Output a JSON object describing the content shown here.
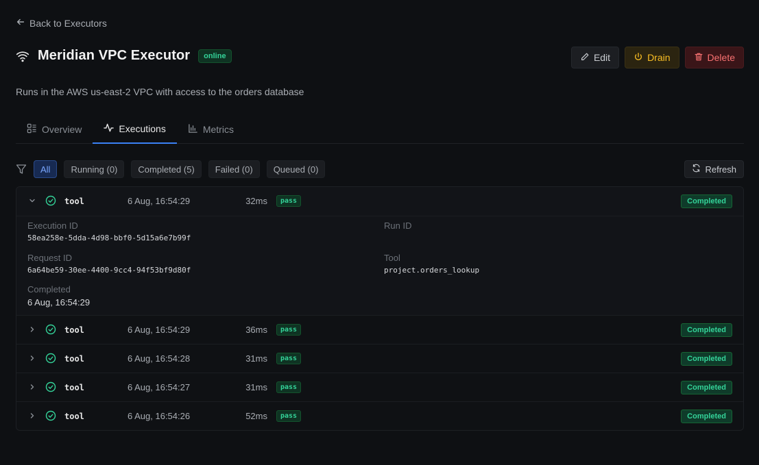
{
  "nav": {
    "back_label": "Back to Executors"
  },
  "header": {
    "title": "Meridian VPC Executor",
    "status_badge": "online",
    "description": "Runs in the AWS us-east-2 VPC with access to the orders database"
  },
  "actions": {
    "edit": "Edit",
    "drain": "Drain",
    "delete": "Delete"
  },
  "tabs": [
    {
      "label": "Overview",
      "icon": "overview-icon"
    },
    {
      "label": "Executions",
      "icon": "activity-icon",
      "active": true
    },
    {
      "label": "Metrics",
      "icon": "bar-chart-icon"
    }
  ],
  "filters": {
    "chips": [
      "All",
      "Running (0)",
      "Completed (5)",
      "Failed (0)",
      "Queued (0)"
    ],
    "active": "All",
    "refresh_label": "Refresh"
  },
  "executions": [
    {
      "kind": "tool",
      "time": "6 Aug, 16:54:29",
      "duration": "32ms",
      "result": "pass",
      "status": "Completed",
      "expanded": true
    },
    {
      "kind": "tool",
      "time": "6 Aug, 16:54:29",
      "duration": "36ms",
      "result": "pass",
      "status": "Completed"
    },
    {
      "kind": "tool",
      "time": "6 Aug, 16:54:28",
      "duration": "31ms",
      "result": "pass",
      "status": "Completed"
    },
    {
      "kind": "tool",
      "time": "6 Aug, 16:54:27",
      "duration": "31ms",
      "result": "pass",
      "status": "Completed"
    },
    {
      "kind": "tool",
      "time": "6 Aug, 16:54:26",
      "duration": "52ms",
      "result": "pass",
      "status": "Completed"
    }
  ],
  "details": {
    "execution_id_label": "Execution ID",
    "execution_id": "58ea258e-5dda-4d98-bbf0-5d15a6e7b99f",
    "run_id_label": "Run ID",
    "request_id_label": "Request ID",
    "request_id": "6a64be59-30ee-4400-9cc4-94f53bf9d80f",
    "tool_label": "Tool",
    "tool": "project.orders_lookup",
    "completed_label": "Completed",
    "completed": "6 Aug, 16:54:29"
  },
  "colors": {
    "accent": "#3b82f6",
    "success": "#34d399",
    "warning": "#fbbf24",
    "danger": "#f87171",
    "background": "#0e1013"
  }
}
